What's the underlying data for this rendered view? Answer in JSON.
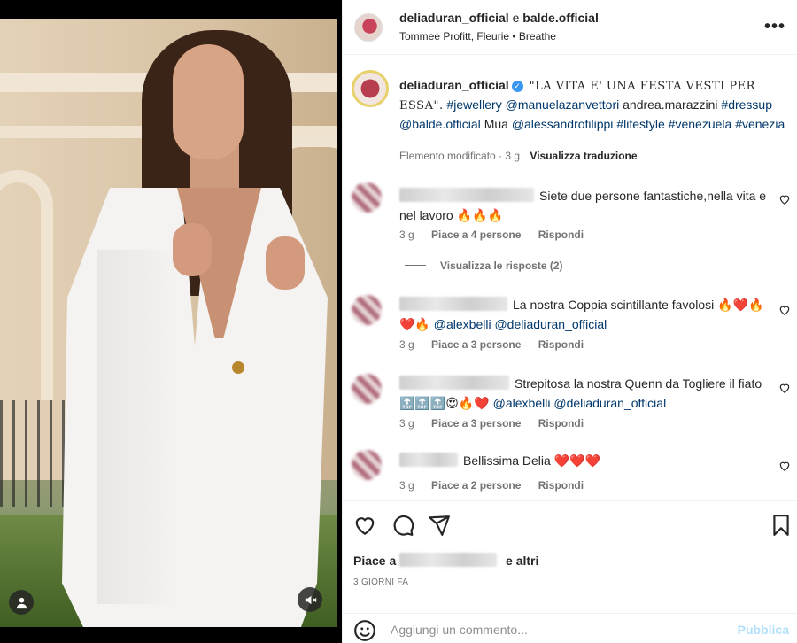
{
  "post": {
    "media": {
      "user_tag_icon": "person-icon",
      "mute_icon": "speaker-muted-icon"
    },
    "header": {
      "author1": "deliaduran_official",
      "connector": "e",
      "author2": "balde.official",
      "audio": "Tommee Profitt, Fleurie • Breathe",
      "more_icon": "more-icon",
      "more_label": "•••"
    },
    "caption": {
      "username": "deliaduran_official",
      "verified_mark": "✓",
      "quote": "\"LA VITA E' UNA FESTA VESTI PER ESSA\".",
      "tag1": "#jewellery",
      "tag2": "@manuelazanvettori",
      "plain1": "andrea.marazzini",
      "tag3": "#dressup",
      "tag4": "@balde.official",
      "plain2": "Mua",
      "tag5": "@alessandrofilippi",
      "tag6": "#lifestyle",
      "tag7": "#venezuela",
      "tag8": "#venezia",
      "meta_edited": "Elemento modificato · 3 g",
      "meta_translate": "Visualizza traduzione"
    },
    "comments": [
      {
        "text": "Siete due persone fantastiche,nella vita e nel lavoro",
        "emoji": "🔥🔥🔥",
        "time": "3 g",
        "likes": "Piace a 4 persone",
        "reply": "Rispondi"
      },
      {
        "text": "La nostra Coppia scintillante favolosi",
        "emoji": "🔥❤️🔥❤️🔥",
        "mention1": "@alexbelli",
        "mention2": "@deliaduran_official",
        "time": "3 g",
        "likes": "Piace a 3 persone",
        "reply": "Rispondi"
      },
      {
        "text": "Strepitosa la nostra Quenn da Togliere il fiato",
        "emoji": "🔝🔝🔝😍🔥❤️",
        "mention1": "@alexbelli",
        "mention2": "@deliaduran_official",
        "time": "3 g",
        "likes": "Piace a 3 persone",
        "reply": "Rispondi"
      },
      {
        "text": "Bellissima Delia",
        "emoji": "❤️❤️❤️",
        "time": "3 g",
        "likes": "Piace a 2 persone",
        "reply": "Rispondi"
      }
    ],
    "view_replies": "Visualizza le risposte (2)",
    "actions": {
      "like_icon": "heart-icon",
      "comment_icon": "comment-icon",
      "share_icon": "share-icon",
      "save_icon": "bookmark-icon",
      "likes_prefix": "Piace a",
      "likes_suffix": "e altri",
      "date": "3 GIORNI FA"
    },
    "add_comment": {
      "emoji_icon": "emoji-icon",
      "placeholder": "Aggiungi un commento...",
      "post_label": "Pubblica"
    }
  }
}
